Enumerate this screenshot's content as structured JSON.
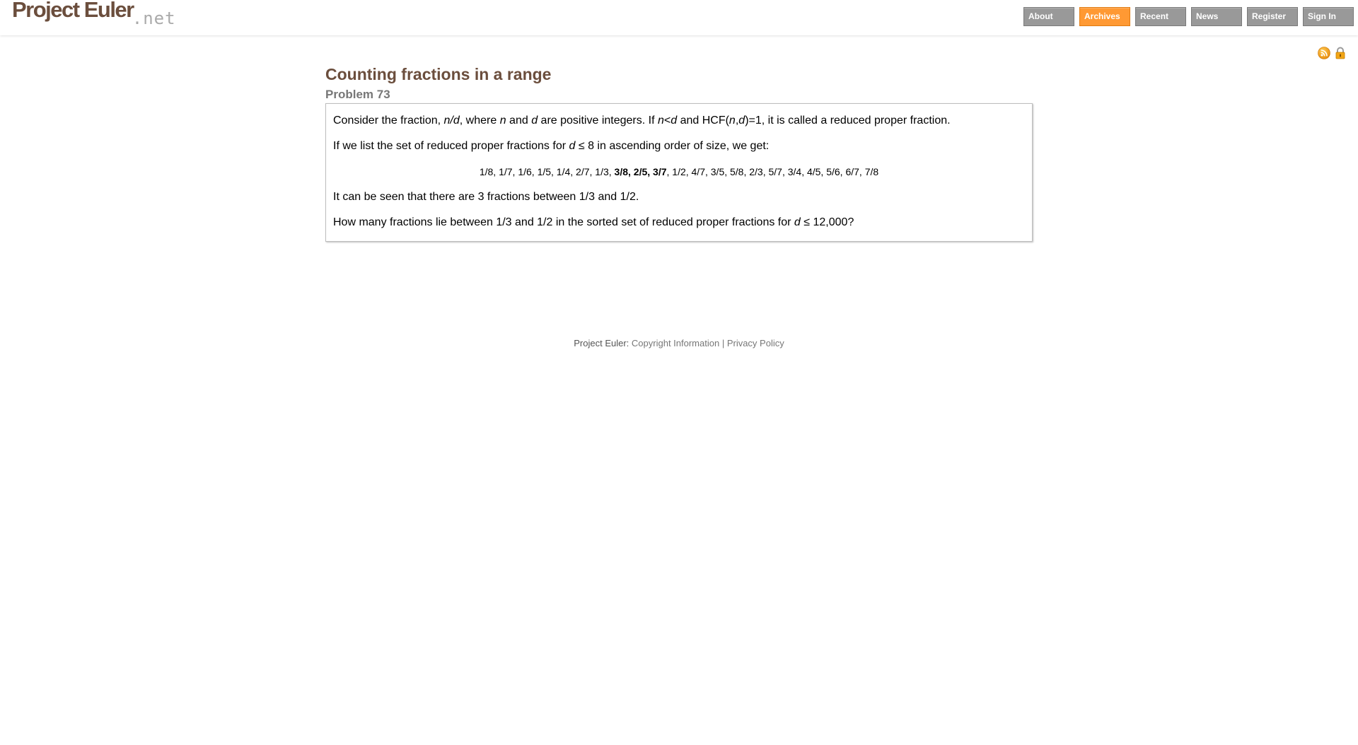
{
  "header": {
    "logo_main": "Project Euler",
    "logo_suffix": ".net",
    "nav": [
      {
        "label": "About",
        "active": false
      },
      {
        "label": "Archives",
        "active": true
      },
      {
        "label": "Recent",
        "active": false
      },
      {
        "label": "News",
        "active": false
      },
      {
        "label": "Register",
        "active": false
      },
      {
        "label": "Sign In",
        "active": false
      }
    ]
  },
  "icons": {
    "rss": "rss-icon",
    "lock": "lock-icon"
  },
  "problem": {
    "title": "Counting fractions in a range",
    "number": "Problem 73",
    "p1": {
      "a": "Consider the fraction, ",
      "n_over_d": "n/d",
      "b": ", where ",
      "n": "n",
      "c": " and ",
      "d": "d",
      "e": " are positive integers. If ",
      "n2": "n",
      "lt": "<",
      "d2": "d",
      "f": " and HCF(",
      "n3": "n",
      "comma": ",",
      "d3": "d",
      "g": ")=1, it is called a reduced proper fraction."
    },
    "p2": {
      "a": "If we list the set of reduced proper fractions for ",
      "d": "d",
      "b": " ≤ 8 in ascending order of size, we get:"
    },
    "fractions": {
      "before": "1/8, 1/7, 1/6, 1/5, 1/4, 2/7, 1/3, ",
      "highlight": "3/8, 2/5, 3/7",
      "after": ", 1/2, 4/7, 3/5, 5/8, 2/3, 5/7, 3/4, 4/5, 5/6, 6/7, 7/8"
    },
    "p3": "It can be seen that there are 3 fractions between 1/3 and 1/2.",
    "p4": {
      "a": "How many fractions lie between 1/3 and 1/2 in the sorted set of reduced proper fractions for ",
      "d": "d",
      "b": " ≤ 12,000?"
    }
  },
  "footer": {
    "prefix": "Project Euler: ",
    "copyright": "Copyright Information",
    "separator": " | ",
    "privacy": "Privacy Policy"
  },
  "colors": {
    "brand": "#6b4e3d",
    "nav_default": "#999999",
    "nav_active": "#ff9933"
  }
}
